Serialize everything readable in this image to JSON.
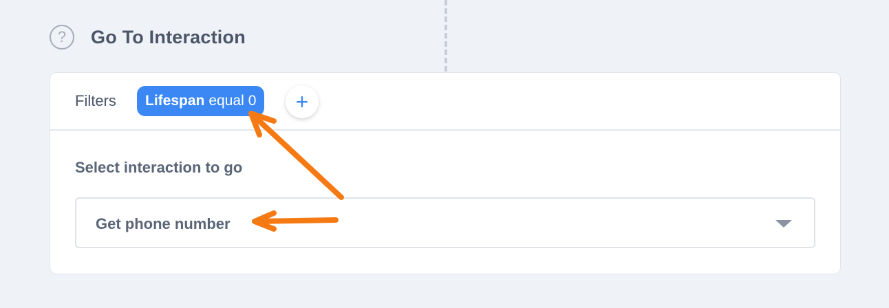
{
  "header": {
    "help_icon": "question-mark-circle-icon",
    "help_glyph": "?",
    "title": "Go To Interaction"
  },
  "filters": {
    "label": "Filters",
    "chip": {
      "key": "Lifespan",
      "operator": "equal",
      "value": "0"
    },
    "add_button": {
      "icon": "plus-icon",
      "glyph": "+"
    }
  },
  "select_interaction": {
    "label": "Select interaction to go",
    "selected_value": "Get phone number",
    "caret_icon": "caret-down-icon"
  },
  "colors": {
    "background": "#eff2f6",
    "card": "#ffffff",
    "accent_blue": "#3b88f5",
    "text": "#4a5568",
    "annotation_orange": "#f57a14"
  }
}
